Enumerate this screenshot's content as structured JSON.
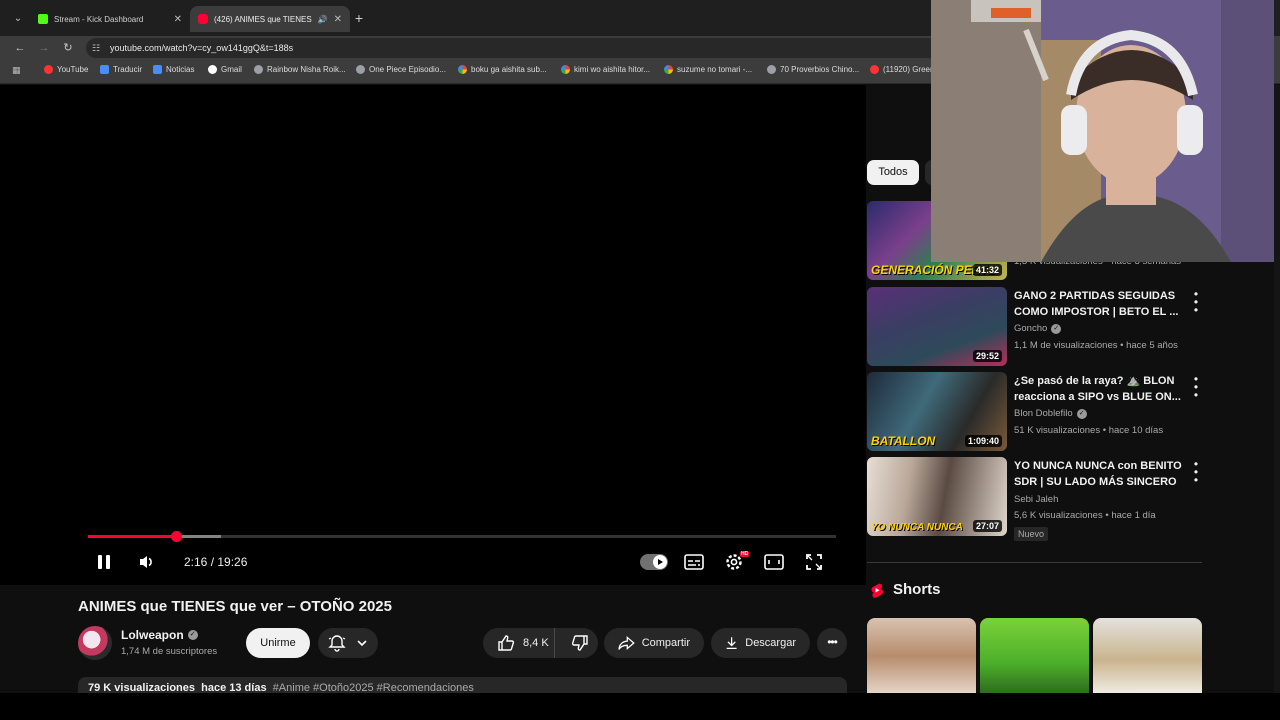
{
  "browser": {
    "tabs": [
      {
        "title": "Stream - Kick Dashboard",
        "favicon": "kick-icon"
      },
      {
        "title": "(426) ANIMES que TIENES ...",
        "favicon": "youtube-icon"
      }
    ],
    "url": "youtube.com/watch?v=cy_ow141ggQ&t=188s",
    "bookmarks": [
      {
        "label": "YouTube",
        "icon": "youtube-icon"
      },
      {
        "label": "Traducir",
        "icon": "translate-icon"
      },
      {
        "label": "Noticias",
        "icon": "news-icon"
      },
      {
        "label": "Gmail",
        "icon": "gmail-icon"
      },
      {
        "label": "Rainbow Nisha Roik...",
        "icon": "anime-icon"
      },
      {
        "label": "One Piece Episodio...",
        "icon": "anime-icon"
      },
      {
        "label": "boku ga aishita sub...",
        "icon": "google-icon"
      },
      {
        "label": "kimi wo aishita hitor...",
        "icon": "google-icon"
      },
      {
        "label": "suzume no tomari -...",
        "icon": "google-icon"
      },
      {
        "label": "70 Proverbios Chino...",
        "icon": "site-icon"
      },
      {
        "label": "(11920) Green",
        "icon": "youtube-icon"
      }
    ]
  },
  "player": {
    "time_display": "2:16 / 19:26",
    "progress_fraction": 0.118,
    "buffer_fraction": 0.178
  },
  "video": {
    "title": "ANIMES que TIENES que ver – OTOÑO 2025",
    "channel": "Lolweapon",
    "subscribers": "1,74 M de suscriptores",
    "join_label": "Unirme",
    "likes": "8,4 K",
    "share_label": "Compartir",
    "download_label": "Descargar",
    "views": "79 K visualizaciones",
    "age": "hace 13 días",
    "tags": "#Anime #Otoño2025 #Recomendaciones"
  },
  "sidebar": {
    "chip_all": "Todos",
    "partial_item": {
      "duration": "41:32",
      "thumb_text": "GENERACIÓN PERTE",
      "meta": "1,3 K visualizaciones • hace 3 semanas"
    },
    "items": [
      {
        "title": "GANO 2 PARTIDAS SEGUIDAS COMO IMPOSTOR | BETO EL ...",
        "channel": "Goncho",
        "verified": true,
        "views": "1,1 M de visualizaciones",
        "age": "hace 5 años",
        "duration": "29:52"
      },
      {
        "title": "¿Se pasó de la raya? ⛰️ BLON reacciona a SIPO vs BLUE ON...",
        "channel": "Blon Doblefilo",
        "verified": true,
        "views": "51 K visualizaciones",
        "age": "hace 10 días",
        "duration": "1:09:40",
        "thumb_text": "BATALLON"
      },
      {
        "title": "YO NUNCA NUNCA con BENITO SDR | SU LADO MÁS SINCERO",
        "channel": "Sebi Jaleh",
        "verified": false,
        "views": "5,6 K visualizaciones",
        "age": "hace 1 día",
        "duration": "27:07",
        "badge": "Nuevo",
        "thumb_text": "YO NUNCA NUNCA"
      }
    ],
    "shorts_title": "Shorts"
  },
  "colors": {
    "accent": "#ff0033",
    "background": "#0f0f0f",
    "pill": "#272727"
  }
}
